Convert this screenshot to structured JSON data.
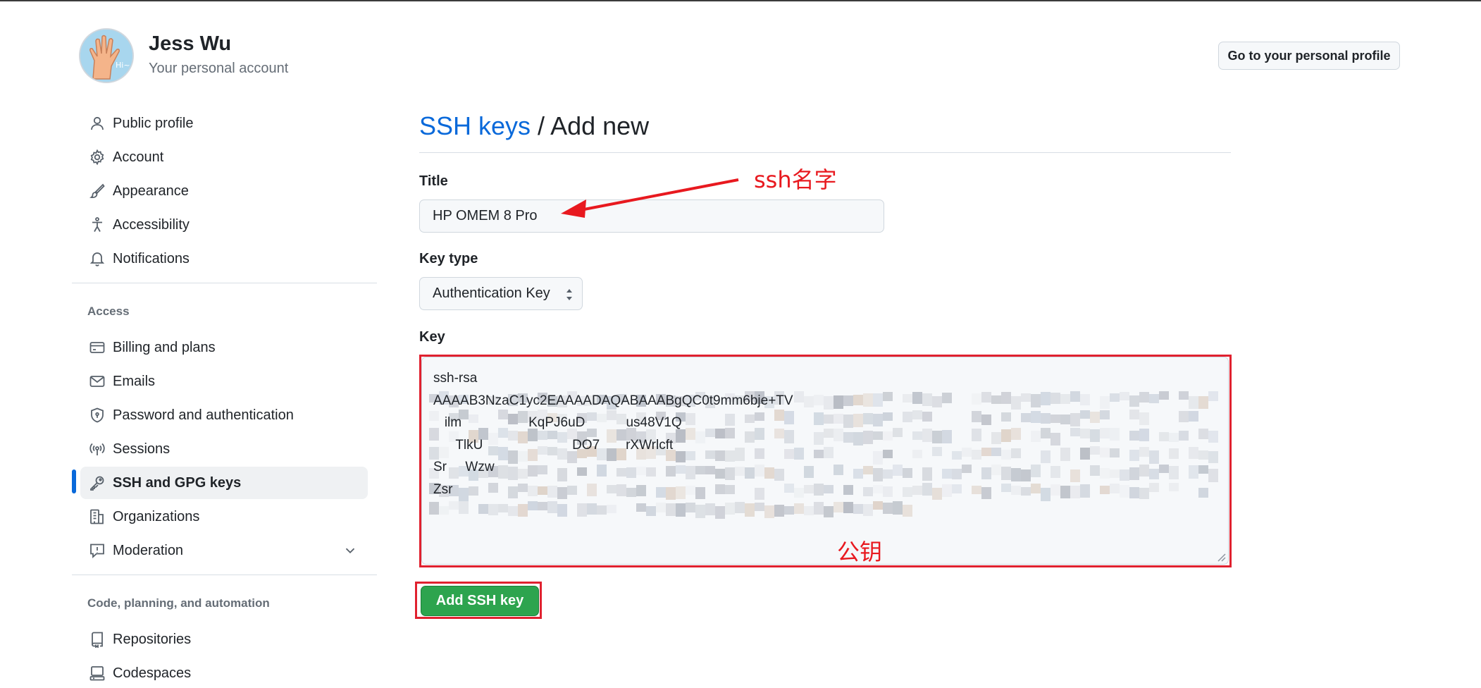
{
  "header": {
    "user_name": "Jess Wu",
    "user_subtitle": "Your personal account",
    "profile_button": "Go to your personal profile"
  },
  "sidebar": {
    "items": [
      {
        "label": "Public profile",
        "icon": "person-icon"
      },
      {
        "label": "Account",
        "icon": "gear-icon"
      },
      {
        "label": "Appearance",
        "icon": "paintbrush-icon"
      },
      {
        "label": "Accessibility",
        "icon": "accessibility-icon"
      },
      {
        "label": "Notifications",
        "icon": "bell-icon"
      }
    ],
    "section_access": "Access",
    "access_items": [
      {
        "label": "Billing and plans",
        "icon": "credit-card-icon"
      },
      {
        "label": "Emails",
        "icon": "mail-icon"
      },
      {
        "label": "Password and authentication",
        "icon": "shield-lock-icon"
      },
      {
        "label": "Sessions",
        "icon": "broadcast-icon"
      },
      {
        "label": "SSH and GPG keys",
        "icon": "key-icon",
        "active": true
      },
      {
        "label": "Organizations",
        "icon": "organization-icon"
      },
      {
        "label": "Moderation",
        "icon": "report-icon"
      }
    ],
    "section_code": "Code, planning, and automation",
    "code_items": [
      {
        "label": "Repositories",
        "icon": "repo-icon"
      },
      {
        "label": "Codespaces",
        "icon": "codespaces-icon"
      }
    ]
  },
  "main": {
    "breadcrumb_link": "SSH keys",
    "breadcrumb_sep": " / ",
    "breadcrumb_current": "Add new",
    "title_label": "Title",
    "title_value": "HP OMEM 8 Pro",
    "key_type_label": "Key type",
    "key_type_value": "Authentication Key",
    "key_label": "Key",
    "key_lines": [
      "ssh-rsa",
      "AAAAB3NzaC1yc2EAAAADAQABAAABgQC0t9mm6bje+TV",
      "",
      "   ilm                  KqPJ6uD           us48V1Q",
      "      TlkU                        DO7       rXWrlcft",
      "Sr     Wzw",
      "Zsr"
    ],
    "submit_button": "Add SSH key"
  },
  "annotations": {
    "title_note": "ssh名字",
    "key_note": "公钥",
    "color": "#e8191f"
  },
  "colors": {
    "link": "#0969da",
    "primary_button": "#2da44e",
    "active_indicator": "#0969da"
  }
}
